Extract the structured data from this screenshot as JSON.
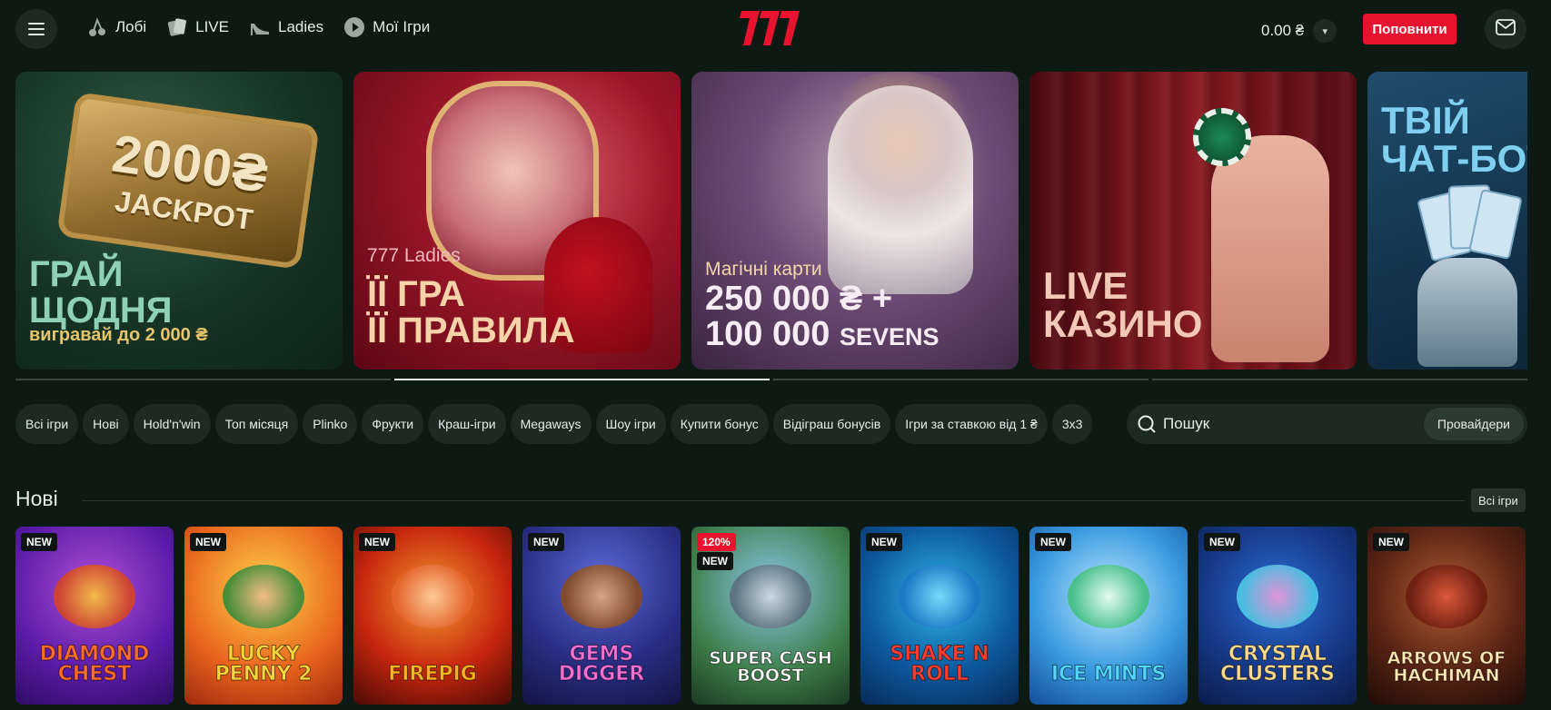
{
  "header": {
    "nav": [
      {
        "label": "Лобі",
        "icon": "cherries-icon"
      },
      {
        "label": "LIVE",
        "icon": "cards-icon"
      },
      {
        "label": "Ladies",
        "icon": "heel-icon"
      },
      {
        "label": "Мої Ігри",
        "icon": "play-icon"
      }
    ],
    "logo_text": "777",
    "balance": "0.00 ₴",
    "deposit_label": "Поповнити",
    "accent_color": "#e8132e"
  },
  "banners": [
    {
      "badge_big": "2000₴",
      "badge_small": "JACKPOT",
      "title_line1": "ГРАЙ",
      "title_line2": "ЩОДНЯ",
      "subtitle": "вигравай до 2 000 ₴"
    },
    {
      "kicker": "777 Ladies",
      "title_line1": "ЇЇ ГРА",
      "title_line2": "ЇЇ ПРАВИЛА"
    },
    {
      "kicker": "Магічні карти",
      "title_line1": "250 000 ₴ +",
      "title_line2_num": "100 000",
      "title_line2_word": "SEVENS"
    },
    {
      "title_line1": "LIVE",
      "title_line2": "КАЗИНО"
    },
    {
      "title_line1": "ТВІЙ",
      "title_line2": "ЧАТ-БОТ"
    }
  ],
  "pager": {
    "count": 4,
    "active": 1
  },
  "categories": [
    "Всі ігри",
    "Нові",
    "Hold'n'win",
    "Топ місяця",
    "Plinko",
    "Фрукти",
    "Краш-ігри",
    "Megaways",
    "Шоу ігри",
    "Купити бонус",
    "Відіграш бонусів",
    "Ігри за ставкою від 1 ₴",
    "3x3"
  ],
  "search": {
    "placeholder": "Пошук",
    "providers_label": "Провайдери"
  },
  "section": {
    "title": "Нові",
    "all_label": "Всі ігри"
  },
  "games": [
    {
      "name": "Diamond Chest",
      "badges": [
        "NEW"
      ]
    },
    {
      "name": "Lucky Penny 2",
      "badges": [
        "NEW"
      ]
    },
    {
      "name": "Firepig",
      "badges": [
        "NEW"
      ]
    },
    {
      "name": "Gems Digger",
      "badges": [
        "NEW"
      ]
    },
    {
      "name": "Super Cash Boost",
      "badges": [
        "120%",
        "NEW"
      ]
    },
    {
      "name": "Shake N Roll",
      "badges": [
        "NEW"
      ]
    },
    {
      "name": "Ice Mints",
      "badges": [
        "NEW"
      ]
    },
    {
      "name": "Crystal Clusters",
      "badges": [
        "NEW"
      ]
    },
    {
      "name": "Arrows of Hachiman",
      "badges": [
        "NEW"
      ]
    }
  ]
}
